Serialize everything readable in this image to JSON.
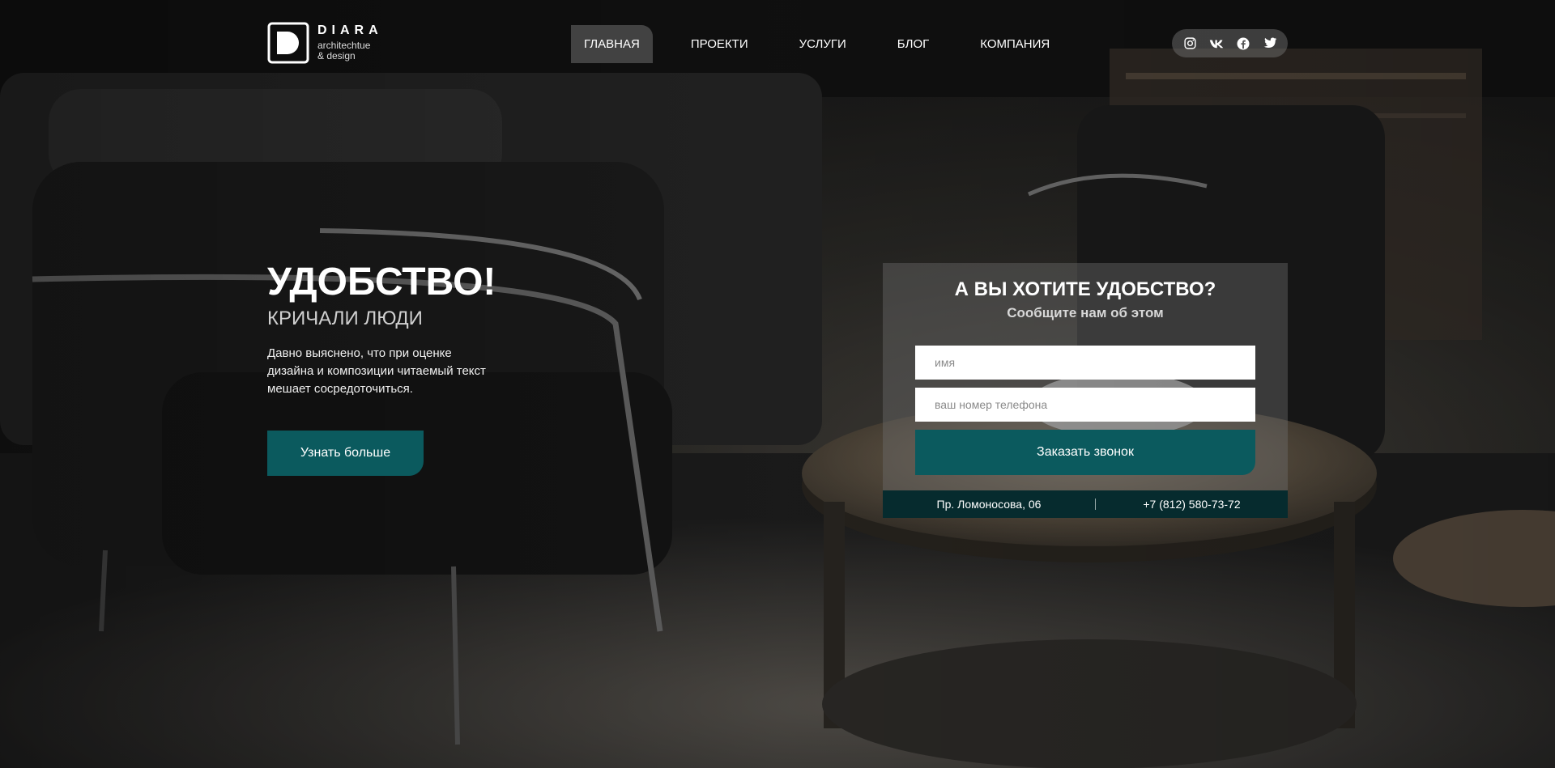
{
  "brand": {
    "name": "DIARA",
    "tagline_line1": "architechtue",
    "tagline_line2": "& design"
  },
  "nav": {
    "items": [
      {
        "label": "ГЛАВНАЯ",
        "active": true
      },
      {
        "label": "ПРОЕКТИ",
        "active": false
      },
      {
        "label": "УСЛУГИ",
        "active": false
      },
      {
        "label": "БЛОГ",
        "active": false
      },
      {
        "label": "КОМПАНИЯ",
        "active": false
      }
    ]
  },
  "social": {
    "icons": [
      "instagram-icon",
      "vk-icon",
      "facebook-icon",
      "twitter-icon"
    ]
  },
  "hero": {
    "title": "УДОБСТВО!",
    "subtitle": "КРИЧАЛИ ЛЮДИ",
    "text": "Давно выяснено, что при оценке дизайна и композиции читаемый текст мешает сосредоточиться.",
    "button_label": "Узнать больше"
  },
  "form": {
    "title": "А ВЫ ХОТИТЕ УДОБСТВО?",
    "subtitle": "Сообщите нам об этом",
    "name_placeholder": "имя",
    "phone_placeholder": "ваш номер телефона",
    "submit_label": "Заказать звонок",
    "address": "Пр. Ломоносова, 06",
    "phone": "+7 (812) 580-73-72"
  },
  "colors": {
    "accent": "#0b5a5e",
    "footer_bar": "#062b2e"
  }
}
